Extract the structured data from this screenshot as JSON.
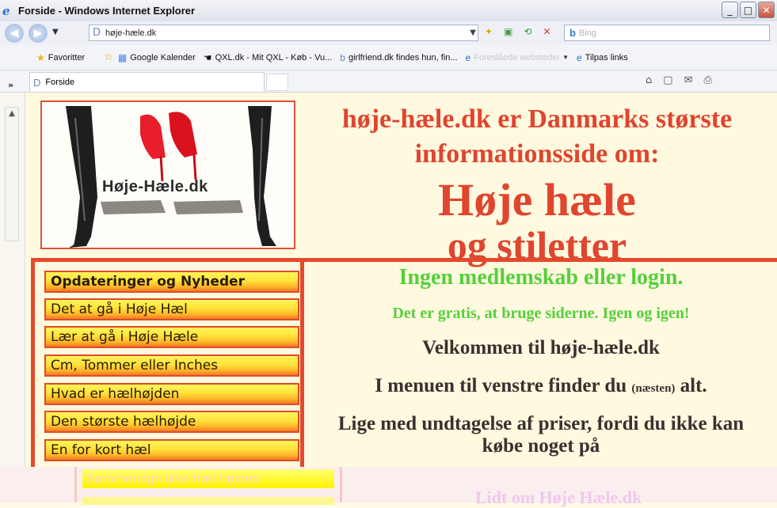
{
  "window": {
    "title": "Forside - Windows Internet Explorer",
    "minimize": "_",
    "maximize": "□",
    "close": "✕"
  },
  "address": {
    "url": "høje-hæle.dk",
    "search_placeholder": "Bing"
  },
  "favorites": {
    "label": "Favoritter",
    "items": [
      {
        "label": "Google Kalender",
        "icon": "google-icon"
      },
      {
        "label": "QXL.dk - Mit QXL - Køb - Vu...",
        "icon": "hand-icon"
      },
      {
        "label": "girlfriend.dk findes hun, fin...",
        "icon": "page-icon"
      },
      {
        "label": "Foreslåede websteder",
        "icon": "ie-icon"
      },
      {
        "label": "Tilpas links",
        "icon": "ie-icon"
      }
    ]
  },
  "tab": {
    "label": "Forside"
  },
  "logo": {
    "text": "Høje-Hæle.dk"
  },
  "headline": {
    "line1": "høje-hæle.dk er Danmarks største",
    "line2": "informationsside om:",
    "big1": "Høje hæle",
    "big2": "og stiletter"
  },
  "menu": {
    "items": [
      "Opdateringer og Nyheder",
      "Det at gå i Høje Hæl",
      "Lær at gå i Høje Hæle",
      "Cm, Tommer eller Inches",
      "Hvad er hælhøjden",
      "Den største hælhøjde",
      "En for kort hæl"
    ],
    "faded_item": "Sammenlign ikke hæl højden"
  },
  "main": {
    "green1": "Ingen medlemskab eller login.",
    "green2": "Det er gratis, at bruge siderne.  Igen og igen!",
    "welcome": "Velkommen til høje-hæle.dk",
    "menu_text_a": "I menuen til venstre finder du",
    "menu_text_small": "(næsten)",
    "menu_text_b": "alt.",
    "except_line1": "Lige med undtagelse af priser, fordi du ikke kan",
    "except_line2": "købe noget på",
    "faded_heading": "Lidt om Høje Hæle.dk"
  },
  "colors": {
    "accent_red": "#e0452f",
    "accent_green": "#55d03a",
    "menu_yellow": "#ffe23a",
    "page_bg": "#fff9df"
  }
}
